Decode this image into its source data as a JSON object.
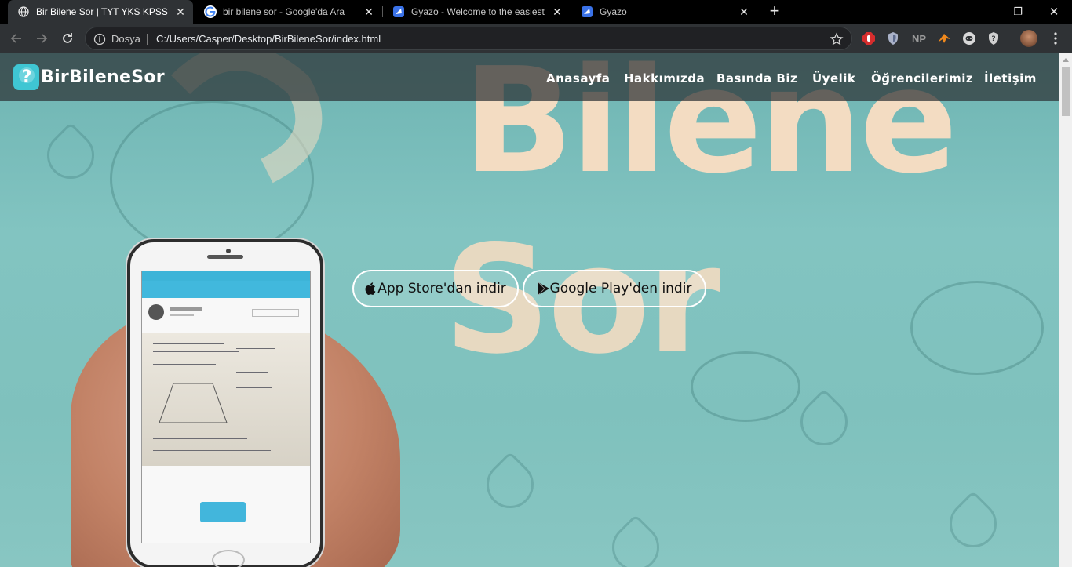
{
  "browser": {
    "tabs": [
      {
        "title": "Bir Bilene Sor | TYT YKS KPSS ALES",
        "favicon": "globe-icon",
        "active": true
      },
      {
        "title": "bir bilene sor - Google'da Ara",
        "favicon": "google-icon",
        "active": false
      },
      {
        "title": "Gyazo - Welcome to the easiest way",
        "favicon": "gyazo-icon",
        "active": false
      },
      {
        "title": "Gyazo",
        "favicon": "gyazo-icon",
        "active": false
      }
    ],
    "new_tab": "+",
    "window_controls": {
      "minimize": "—",
      "restore": "❐",
      "close": "✕"
    },
    "address": {
      "scheme_label": "Dosya",
      "url": "C:/Users/Casper/Desktop/BirBileneSor/index.html"
    },
    "extensions": [
      "adblock-icon",
      "shield-icon",
      "np-icon",
      "fox-icon",
      "discord-icon",
      "privacy-badger-icon"
    ],
    "extension_np_label": "NP"
  },
  "site": {
    "logo_text": "BirBileneSor",
    "logo_glyph": "?",
    "nav": [
      "Anasayfa",
      "Hakkımızda",
      "Basında Biz",
      "Üyelik",
      "Öğrencilerimiz",
      "İletişim"
    ],
    "buttons": {
      "app_store": "App Store'dan indir",
      "google_play": "Google Play'den indir"
    },
    "colors": {
      "logo_accent": "#3fc6d3",
      "hero_bg": "#7fc1bd"
    }
  }
}
